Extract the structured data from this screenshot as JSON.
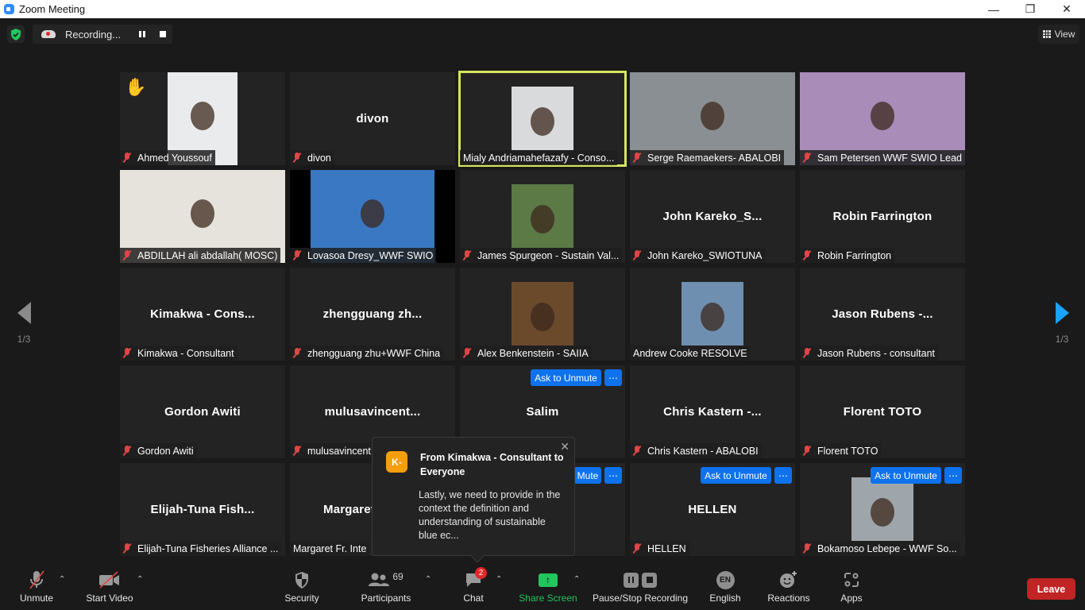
{
  "window": {
    "title": "Zoom Meeting",
    "controls": [
      "minimize",
      "maximize",
      "close"
    ]
  },
  "topbar": {
    "recording_label": "Recording...",
    "view_label": "View"
  },
  "pagination": {
    "left": "1/3",
    "right": "1/3"
  },
  "tiles": [
    {
      "name": "Ahmed Youssouf",
      "video": true,
      "muted": true,
      "hand_raised": true,
      "photo_color": "#e9ebec"
    },
    {
      "name": "divon",
      "display": "divon",
      "video": false,
      "muted": true
    },
    {
      "name": "Mialy Andriamahefazafy - Conso...",
      "video": true,
      "muted": false,
      "active_speaker": true,
      "photo_color": "#d8dadc"
    },
    {
      "name": "Serge Raemaekers- ABALOBI",
      "video": true,
      "muted": true,
      "photo_color": "#8a8f93"
    },
    {
      "name": "Sam Petersen WWF SWIO Lead",
      "video": true,
      "muted": true,
      "photo_color": "#a98cb8"
    },
    {
      "name": "ABDILLAH ali abdallah( MOSC)",
      "video": true,
      "muted": true,
      "photo_color": "#e6e2dc"
    },
    {
      "name": "Lovasoa Dresy_WWF SWIO",
      "video": true,
      "muted": true,
      "photo_color": "#3a78c4"
    },
    {
      "name": "James Spurgeon - Sustain Val...",
      "video": true,
      "muted": true,
      "photo_color": "#5b7a46"
    },
    {
      "name": "John Kareko_SWIOTUNA",
      "display": "John  Kareko_S...",
      "video": false,
      "muted": true
    },
    {
      "name": "Robin Farrington",
      "display": "Robin Farrington",
      "video": false,
      "muted": true
    },
    {
      "name": "Kimakwa - Consultant",
      "display": "Kimakwa  - Cons...",
      "video": false,
      "muted": true
    },
    {
      "name": "zhengguang zhu+WWF China",
      "display": "zhengguang  zh...",
      "video": false,
      "muted": true
    },
    {
      "name": "Alex Benkenstein - SAIIA",
      "video": true,
      "muted": true,
      "photo_color": "#6b4a2c"
    },
    {
      "name": "Andrew Cooke RESOLVE",
      "video": true,
      "muted": false,
      "photo_color": "#6f8fb0"
    },
    {
      "name": "Jason Rubens - consultant",
      "display": "Jason Rubens -...",
      "video": false,
      "muted": true
    },
    {
      "name": "Gordon Awiti",
      "display": "Gordon Awiti",
      "video": false,
      "muted": true
    },
    {
      "name": "mulusavincent",
      "display": "mulusavincent...",
      "video": false,
      "muted": true
    },
    {
      "name": "",
      "display": "Salim",
      "video": false,
      "muted": false,
      "buttons": [
        "Ask to Unmute",
        "..."
      ]
    },
    {
      "name": "Chris Kastern - ABALOBI",
      "display": "Chris  Kastern -...",
      "video": false,
      "muted": true
    },
    {
      "name": "Florent TOTO",
      "display": "Florent TOTO",
      "video": false,
      "muted": true
    },
    {
      "name": "Elijah-Tuna Fisheries Alliance ...",
      "display": "Elijah-Tuna  Fish...",
      "video": false,
      "muted": true
    },
    {
      "name": "Margaret Fr. Inte",
      "display": "Margaret",
      "video": false,
      "muted": false
    },
    {
      "name": "",
      "display": "",
      "video": false,
      "muted": false,
      "buttons": [
        "Mute",
        "..."
      ]
    },
    {
      "name": "HELLEN",
      "display": "HELLEN",
      "video": false,
      "muted": true,
      "buttons": [
        "Ask to Unmute",
        "..."
      ]
    },
    {
      "name": "Bokamoso Lebepe - WWF So...",
      "video": true,
      "muted": true,
      "photo_color": "#9fa6ab",
      "buttons": [
        "Ask to Unmute",
        "..."
      ]
    }
  ],
  "chat_popup": {
    "avatar_initials": "K-",
    "from": "From Kimakwa - Consultant to Everyone",
    "message": "Lastly, we need to provide in the context the definition and understanding of sustainable blue ec..."
  },
  "toolbar": {
    "unmute": "Unmute",
    "start_video": "Start Video",
    "security": "Security",
    "participants": "Participants",
    "participants_count": "69",
    "chat": "Chat",
    "chat_badge": "2",
    "share_screen": "Share Screen",
    "pause_stop_recording": "Pause/Stop Recording",
    "language_code": "EN",
    "language": "English",
    "reactions": "Reactions",
    "apps": "Apps",
    "leave": "Leave"
  },
  "colors": {
    "accent_blue": "#0e72ed",
    "share_green": "#22c55e",
    "leave_red": "#c02424",
    "active_speaker": "#d6e55e"
  }
}
